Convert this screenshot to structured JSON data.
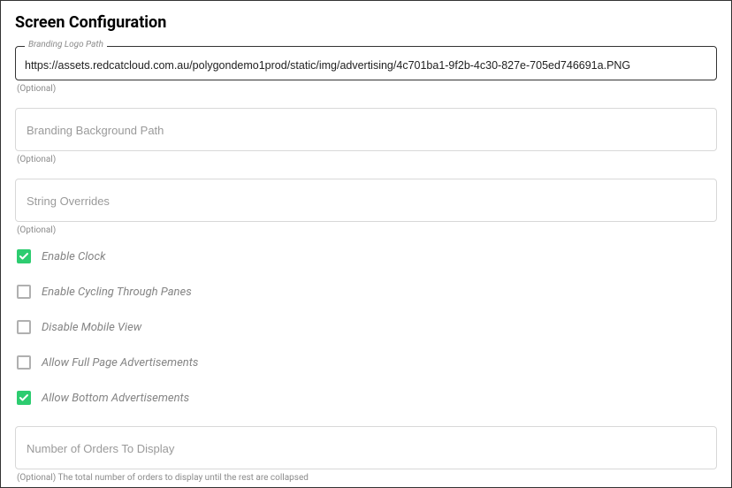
{
  "title": "Screen Configuration",
  "fields": {
    "branding_logo": {
      "label": "Branding Logo Path",
      "value": "https://assets.redcatcloud.com.au/polygondemo1prod/static/img/advertising/4c701ba1-9f2b-4c30-827e-705ed746691a.PNG",
      "helper": "(Optional)"
    },
    "branding_bg": {
      "placeholder": "Branding Background Path",
      "helper": "(Optional)"
    },
    "string_overrides": {
      "placeholder": "String Overrides",
      "helper": "(Optional)"
    },
    "num_orders": {
      "placeholder": "Number of Orders To Display",
      "helper": "(Optional) The total number of orders to display until the rest are collapsed"
    }
  },
  "checkboxes": {
    "enable_clock": {
      "label": "Enable Clock",
      "checked": true
    },
    "enable_cycling": {
      "label": "Enable Cycling Through Panes",
      "checked": false
    },
    "disable_mobile": {
      "label": "Disable Mobile View",
      "checked": false
    },
    "allow_full_ads": {
      "label": "Allow Full Page Advertisements",
      "checked": false
    },
    "allow_bottom_ads": {
      "label": "Allow Bottom Advertisements",
      "checked": true
    }
  }
}
